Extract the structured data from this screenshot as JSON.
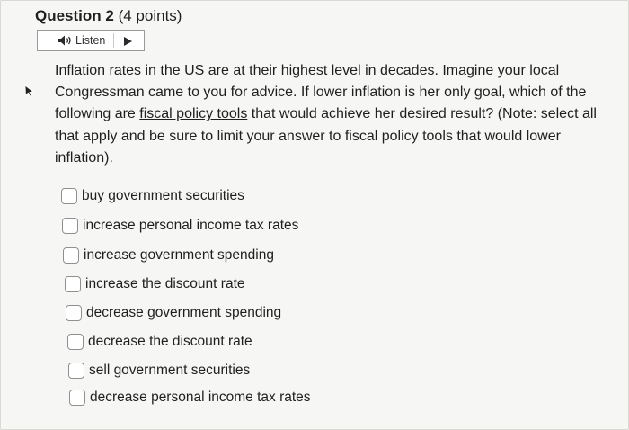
{
  "question": {
    "number_label": "Question 2",
    "points_label": "(4 points)",
    "listen_label": "Listen",
    "text_before_link": "Inflation rates in the US are at their highest level in decades. Imagine your local Congressman came to you for advice. If lower inflation is her only goal, which of the following are ",
    "link_text": "fiscal policy tools",
    "text_after_link": " that would achieve her desired result? (Note: select all that apply and be sure to limit your answer to fiscal policy tools that would lower inflation).",
    "options": [
      {
        "label": "buy government securities",
        "checked": false
      },
      {
        "label": "increase personal income tax rates",
        "checked": false
      },
      {
        "label": "increase government spending",
        "checked": false
      },
      {
        "label": "increase the discount rate",
        "checked": false
      },
      {
        "label": "decrease government spending",
        "checked": false
      },
      {
        "label": "decrease the discount rate",
        "checked": false
      },
      {
        "label": "sell government securities",
        "checked": false
      },
      {
        "label": "decrease personal income tax rates",
        "checked": false
      }
    ]
  },
  "icons": {
    "speaker": "speaker-icon",
    "play": "play-icon",
    "cursor": "pointer-cursor-icon"
  }
}
